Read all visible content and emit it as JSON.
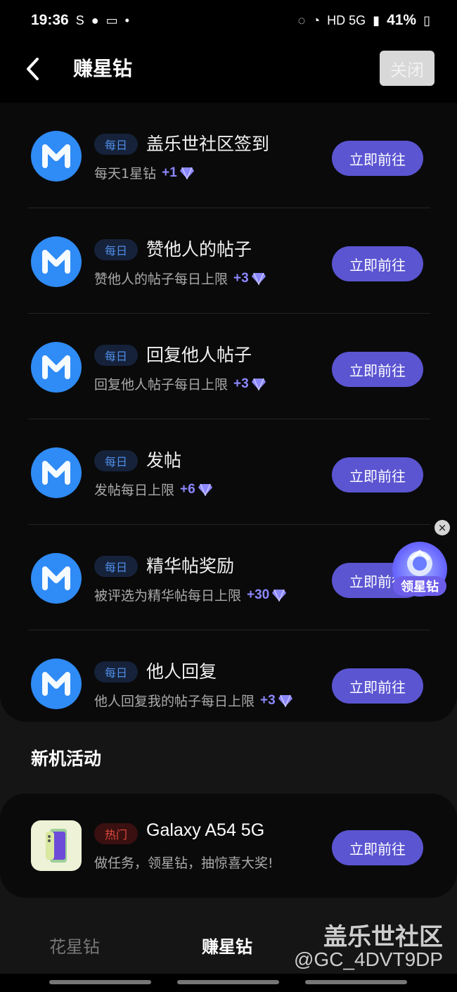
{
  "status": {
    "time": "19:36",
    "battery": "41%",
    "network": "HD 5G"
  },
  "header": {
    "title": "赚星钻",
    "close_label": "关闭"
  },
  "tasks": [
    {
      "badge": "每日",
      "title": "盖乐世社区签到",
      "desc": "每天1星钻",
      "reward": "+1",
      "button": "立即前往"
    },
    {
      "badge": "每日",
      "title": "赞他人的帖子",
      "desc": "赞他人的帖子每日上限",
      "reward": "+3",
      "button": "立即前往"
    },
    {
      "badge": "每日",
      "title": "回复他人帖子",
      "desc": "回复他人帖子每日上限",
      "reward": "+3",
      "button": "立即前往"
    },
    {
      "badge": "每日",
      "title": "发帖",
      "desc": "发帖每日上限",
      "reward": "+6",
      "button": "立即前往"
    },
    {
      "badge": "每日",
      "title": "精华帖奖励",
      "desc": "被评选为精华帖每日上限",
      "reward": "+30",
      "button": "立即前往"
    },
    {
      "badge": "每日",
      "title": "他人回复",
      "desc": "他人回复我的帖子每日上限",
      "reward": "+3",
      "button": "立即前往"
    }
  ],
  "new_activity": {
    "section_title": "新机活动",
    "badge": "热门",
    "title": "Galaxy A54 5G",
    "desc": "做任务，领星钻，抽惊喜大奖!",
    "button": "立即前往"
  },
  "tabs": {
    "spend": "花星钻",
    "earn": "赚星钻"
  },
  "floating": {
    "label": "领星钻",
    "close": "×"
  },
  "watermark": {
    "line1": "盖乐世社区",
    "line2": "@GC_4DVT9DP"
  },
  "colors": {
    "accent": "#5b55d2",
    "icon_blue": "#2f8bf5",
    "reward": "#8c88ff",
    "hot_red": "#e24a3d"
  }
}
